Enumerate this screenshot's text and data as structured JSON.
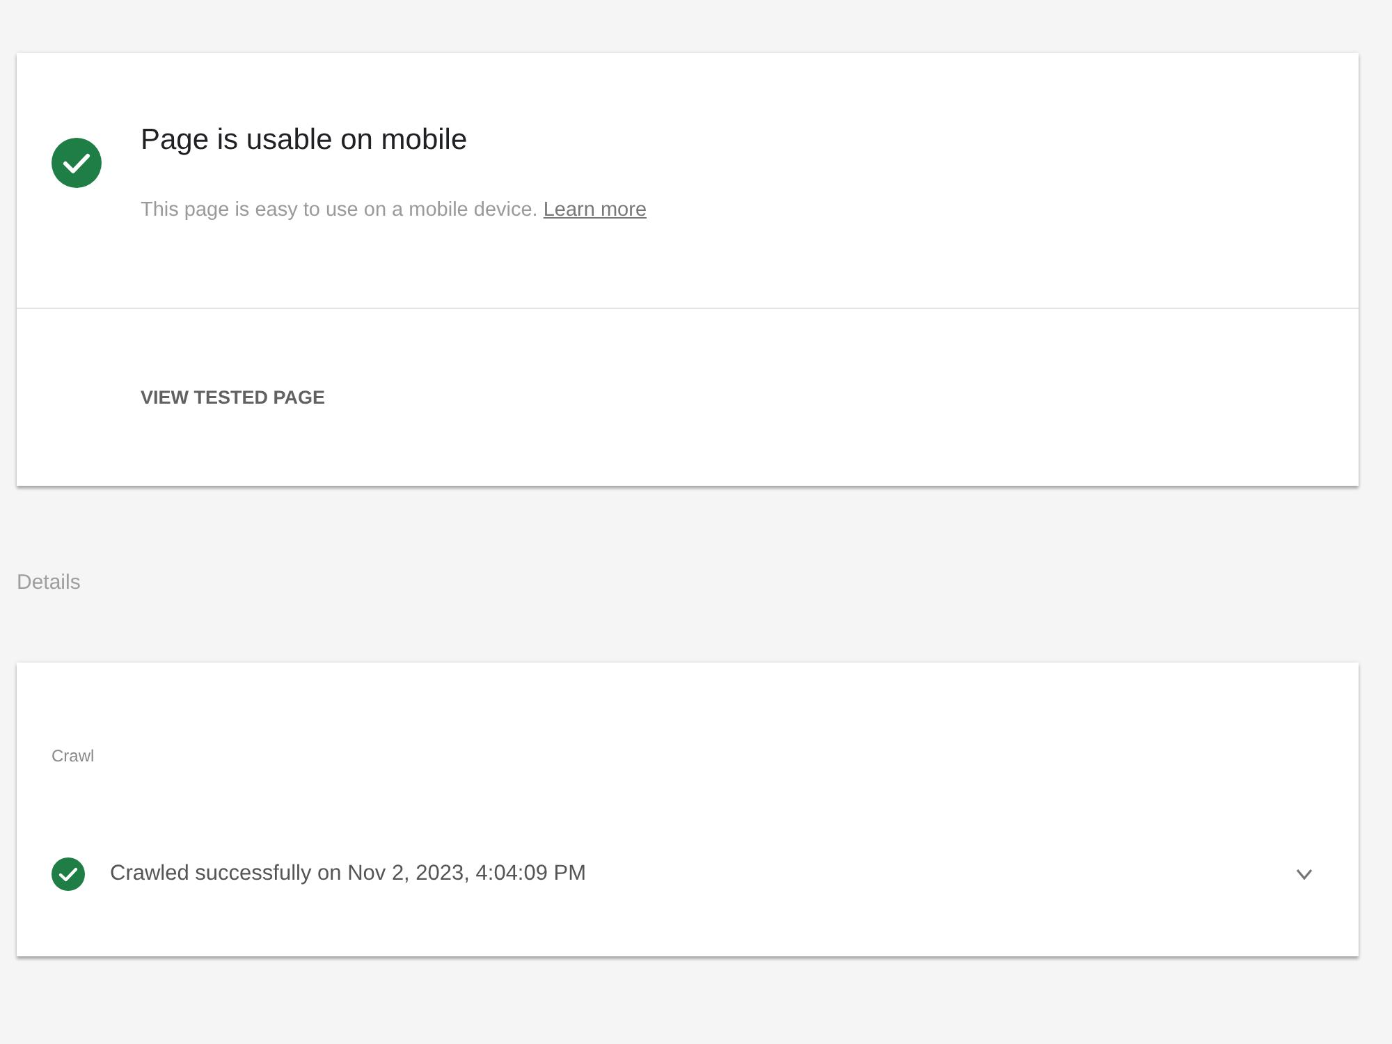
{
  "summary_card": {
    "status": {
      "kind": "success",
      "title": "Page is usable on mobile",
      "description": "This page is easy to use on a mobile device.",
      "link": "Learn more"
    },
    "action": "VIEW TESTED PAGE"
  },
  "details": {
    "heading": "Details",
    "sections": [
      {
        "title": "Crawl",
        "items": [
          {
            "kind": "success",
            "text": "Crawled successfully on Nov 2, 2023, 4:04:09 PM",
            "expanded": false
          }
        ]
      }
    ]
  }
}
